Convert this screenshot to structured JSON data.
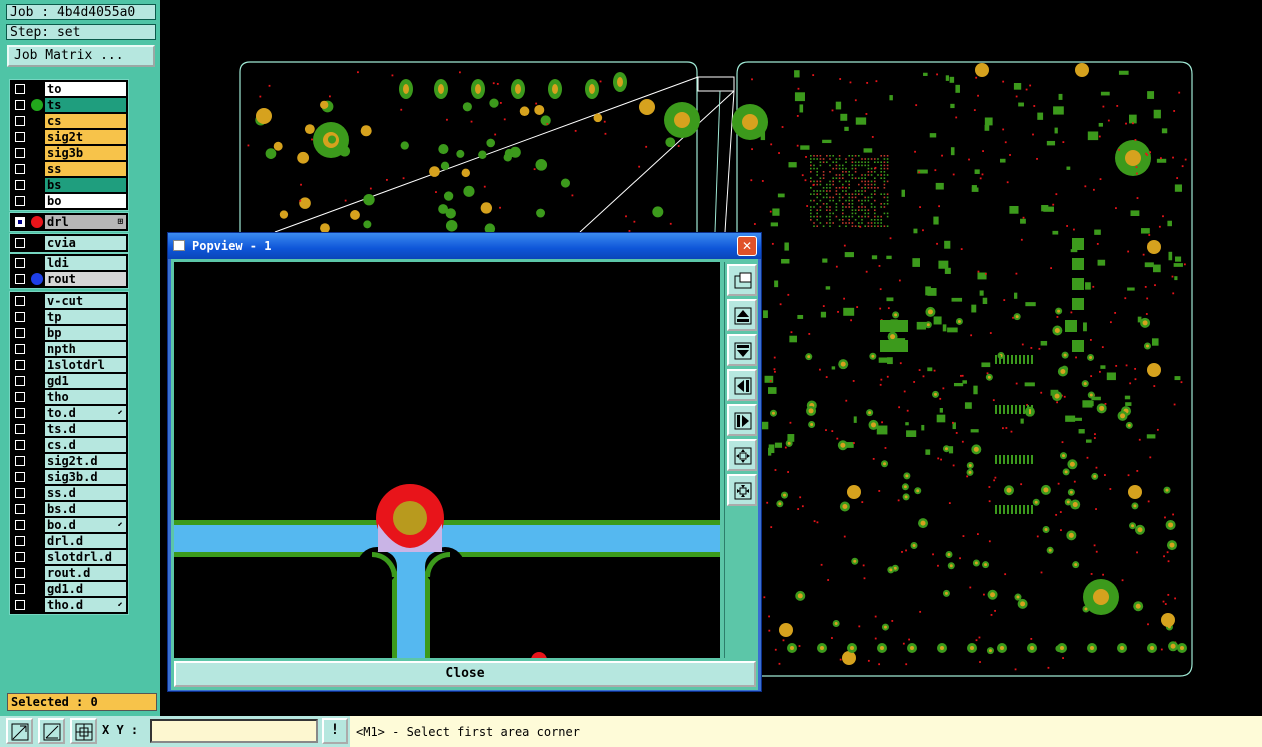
{
  "job_label": "Job : 4b4d4055a0",
  "step_label": "Step: set",
  "job_matrix_button": "Job Matrix ...",
  "layer_groups": [
    [
      {
        "name": "to",
        "color": "#ffffff",
        "dot": ""
      },
      {
        "name": "ts",
        "color": "#1f9e7e",
        "dot": "#22a81c"
      },
      {
        "name": "cs",
        "color": "#f7c34a",
        "dot": ""
      },
      {
        "name": "sig2t",
        "color": "#f7c34a",
        "dot": ""
      },
      {
        "name": "sig3b",
        "color": "#f7c34a",
        "dot": ""
      },
      {
        "name": "ss",
        "color": "#f7c34a",
        "dot": ""
      },
      {
        "name": "bs",
        "color": "#1f9e7e",
        "dot": ""
      },
      {
        "name": "bo",
        "color": "#ffffff",
        "dot": ""
      }
    ],
    [
      {
        "name": "drl",
        "color": "#b7b7b7",
        "dot": "#e8141a",
        "checked": true,
        "mark": "⊞"
      }
    ],
    [
      {
        "name": "cvia",
        "color": "#b6e7df",
        "dot": ""
      }
    ],
    [
      {
        "name": "ldi",
        "color": "#b6e7df",
        "dot": ""
      },
      {
        "name": "rout",
        "color": "#d6d6d6",
        "dot": "#1e3fe8"
      }
    ],
    [
      {
        "name": "v-cut",
        "color": "#b6e7df",
        "dot": ""
      },
      {
        "name": "tp",
        "color": "#b6e7df",
        "dot": ""
      },
      {
        "name": "bp",
        "color": "#b6e7df",
        "dot": ""
      },
      {
        "name": "npth",
        "color": "#b6e7df",
        "dot": ""
      },
      {
        "name": "1slotdrl",
        "color": "#b6e7df",
        "dot": ""
      },
      {
        "name": "gd1",
        "color": "#b6e7df",
        "dot": ""
      },
      {
        "name": "tho",
        "color": "#b6e7df",
        "dot": ""
      },
      {
        "name": "to.d",
        "color": "#b6e7df",
        "dot": "",
        "mark": "⬋"
      },
      {
        "name": "ts.d",
        "color": "#b6e7df",
        "dot": ""
      },
      {
        "name": "cs.d",
        "color": "#b6e7df",
        "dot": ""
      },
      {
        "name": "sig2t.d",
        "color": "#b6e7df",
        "dot": ""
      },
      {
        "name": "sig3b.d",
        "color": "#b6e7df",
        "dot": ""
      },
      {
        "name": "ss.d",
        "color": "#b6e7df",
        "dot": ""
      },
      {
        "name": "bs.d",
        "color": "#b6e7df",
        "dot": ""
      },
      {
        "name": "bo.d",
        "color": "#b6e7df",
        "dot": "",
        "mark": "⬋"
      },
      {
        "name": "drl.d",
        "color": "#b6e7df",
        "dot": ""
      },
      {
        "name": "slotdrl.d",
        "color": "#b6e7df",
        "dot": ""
      },
      {
        "name": "rout.d",
        "color": "#b6e7df",
        "dot": ""
      },
      {
        "name": "gd1.d",
        "color": "#b6e7df",
        "dot": ""
      },
      {
        "name": "tho.d",
        "color": "#b6e7df",
        "dot": "",
        "mark": "⬋"
      }
    ]
  ],
  "selected_label": "Selected : 0",
  "bottom": {
    "tools": [
      "zoom-area-icon",
      "measure-icon",
      "grid-snap-icon"
    ],
    "xy_label": "X Y :",
    "xy_value": "",
    "info_icon": "!",
    "message": "<M1> - Select first area corner"
  },
  "popview": {
    "title": "Popview - 1",
    "close_x": "✕",
    "tools": [
      "zoom-home-icon",
      "pan-up-icon",
      "pan-down-icon",
      "pan-left-icon",
      "pan-right-icon",
      "zoom-out-icon",
      "zoom-in-icon"
    ],
    "close_label": "Close"
  },
  "colors": {
    "panel": "#4fc4a6",
    "board_outline": "#9fe8d4",
    "pad_green": "#3c9a1c",
    "pad_yellow": "#d6a21e",
    "drill_red": "#e8141a",
    "trace_blue": "#55b8f0"
  }
}
